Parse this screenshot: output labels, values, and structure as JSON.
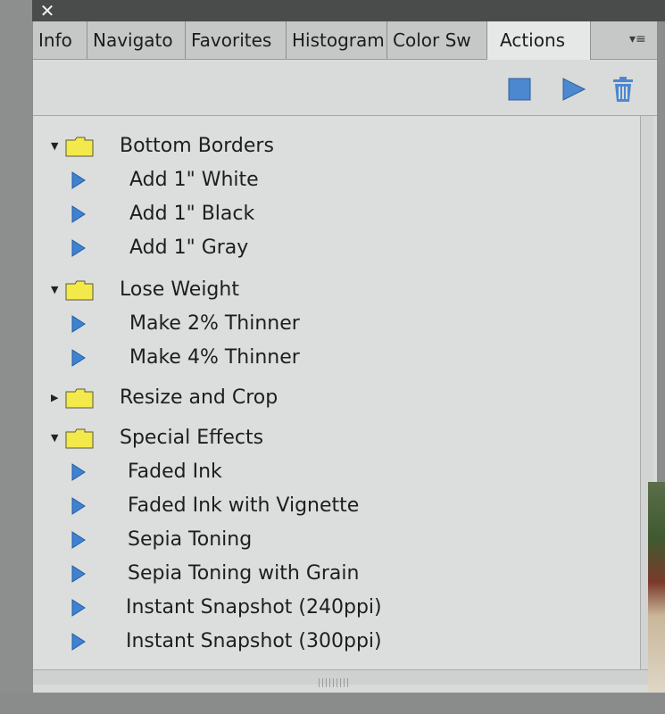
{
  "window": {
    "close_glyph": "✕"
  },
  "tabs": [
    {
      "label": "Info"
    },
    {
      "label": "Navigato"
    },
    {
      "label": "Favorites"
    },
    {
      "label": "Histogram"
    },
    {
      "label": "Color Sw"
    },
    {
      "label": "Actions"
    }
  ],
  "active_tab": "Actions",
  "panel_menu_glyph": "▾≡",
  "toolbar": {
    "stop_icon": "stop-icon",
    "play_icon": "play-icon",
    "trash_icon": "trash-icon"
  },
  "colors": {
    "annotation_underline": "#e8202a",
    "folder_fill": "#f4e94a",
    "play_fill": "#2f73c4"
  },
  "actions": {
    "groups": [
      {
        "name": "Bottom Borders",
        "expanded": true,
        "items": [
          "Add 1\" White",
          "Add 1\" Black",
          "Add 1\" Gray"
        ]
      },
      {
        "name": "Lose Weight",
        "expanded": true,
        "items": [
          "Make 2% Thinner",
          "Make 4% Thinner"
        ]
      },
      {
        "name": "Resize and Crop",
        "expanded": false,
        "items": []
      },
      {
        "name": "Special Effects",
        "expanded": true,
        "items": [
          "Faded Ink",
          "Faded Ink with Vignette",
          "Sepia Toning",
          "Sepia Toning with Grain",
          "Instant Snapshot (240ppi)",
          "Instant Snapshot (300ppi)"
        ]
      }
    ]
  }
}
